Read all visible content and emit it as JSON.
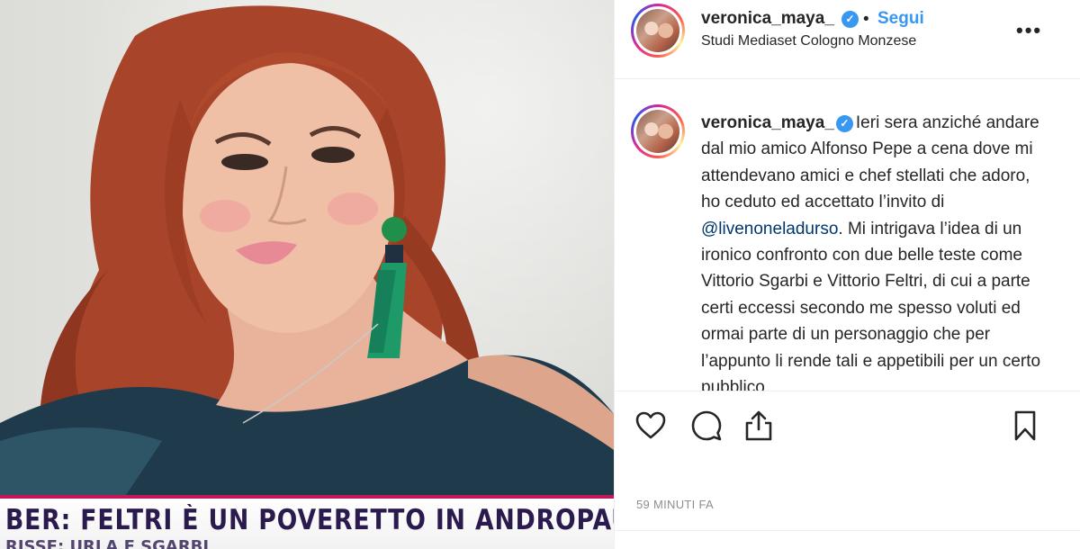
{
  "post": {
    "username": "veronica_maya_",
    "follow_label": "Segui",
    "separator": "•",
    "location": "Studi Mediaset Cologno Monzese",
    "more_icon": "more-options-icon",
    "verified_icon": "verified-badge-icon"
  },
  "media": {
    "ticker_text": "BER: FELTRI È UN POVERETTO IN ANDROPAUSA",
    "ticker_subtext": "RISSE: URLA E SGARBI",
    "ticker_color": "#2a1a4e",
    "accent_color": "#c2185b"
  },
  "caption": {
    "username": "veronica_maya_",
    "text_before_mention": "Ieri sera anziché andare dal mio amico Alfonso Pepe a cena dove mi attendevano amici e chef stellati che adoro, ho ceduto ed accettato l’invito di ",
    "mention": "@livenoneladurso",
    "text_after_mention": ". Mi intrigava l’idea di un ironico confronto con due belle teste come Vittorio Sgarbi e Vittorio Feltri, di cui a parte certi eccessi secondo me spesso voluti ed ormai parte di un personaggio che per l’appunto li rende tali e appetibili per un certo pubblico"
  },
  "actions": {
    "like_icon": "heart-icon",
    "comment_icon": "comment-icon",
    "share_icon": "share-icon",
    "save_icon": "bookmark-icon"
  },
  "timestamp": "59 MINUTI FA",
  "colors": {
    "link_blue": "#3897f0",
    "mention_blue": "#00376b",
    "text": "#262626",
    "muted": "#8e8e8e",
    "border": "#efefef"
  }
}
